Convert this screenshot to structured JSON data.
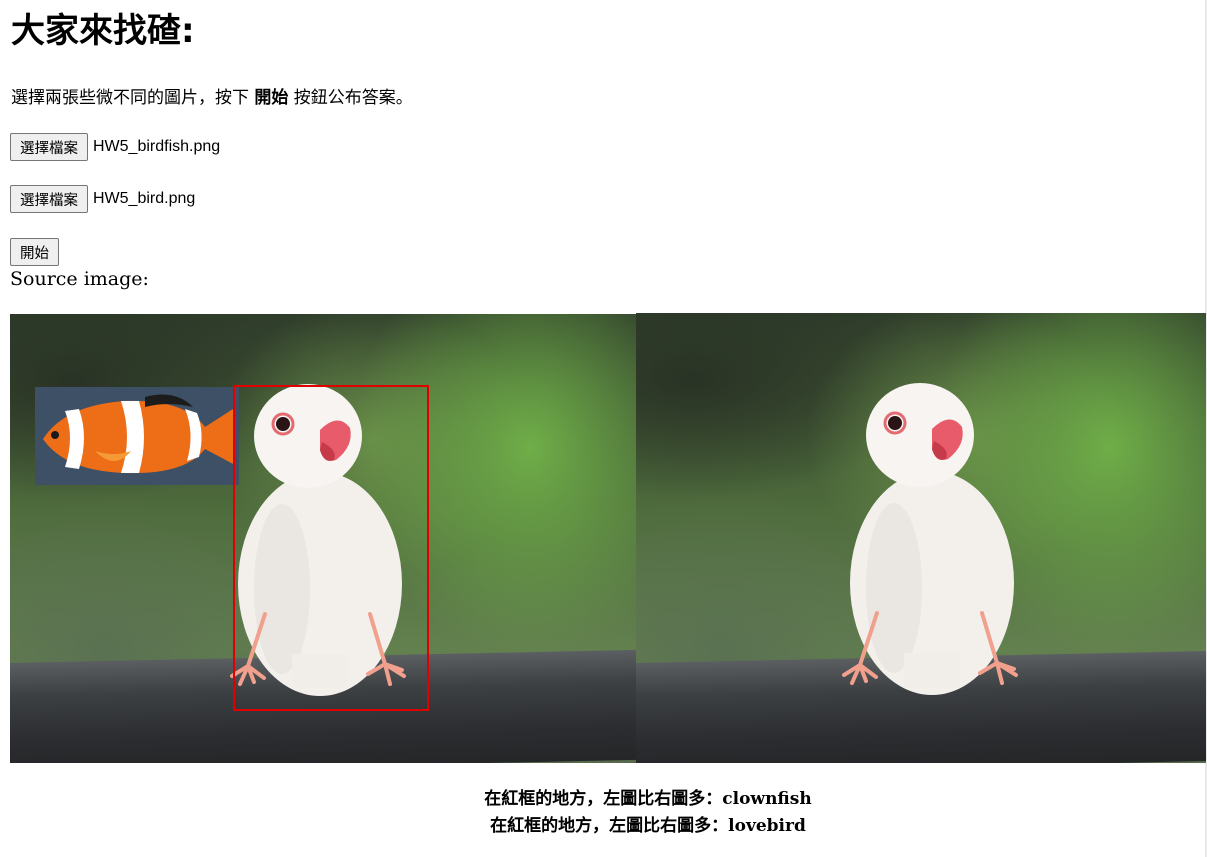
{
  "title": "大家來找碴:",
  "intro": {
    "before": "選擇兩張些微不同的圖片，按下 ",
    "bold": "開始",
    "after": " 按鈕公布答案。"
  },
  "file_inputs": [
    {
      "button_label": "選擇檔案",
      "filename": "HW5_birdfish.png"
    },
    {
      "button_label": "選擇檔案",
      "filename": "HW5_bird.png"
    }
  ],
  "start_button": "開始",
  "source_label": "Source image:",
  "results": [
    {
      "prefix": "在紅框的地方，左圖比右圖多：",
      "item": "clownfish"
    },
    {
      "prefix": "在紅框的地方，左圖比右圖多：",
      "item": "lovebird"
    }
  ],
  "colors": {
    "highlight_box": "#e00000",
    "button_bg": "#efefef"
  }
}
